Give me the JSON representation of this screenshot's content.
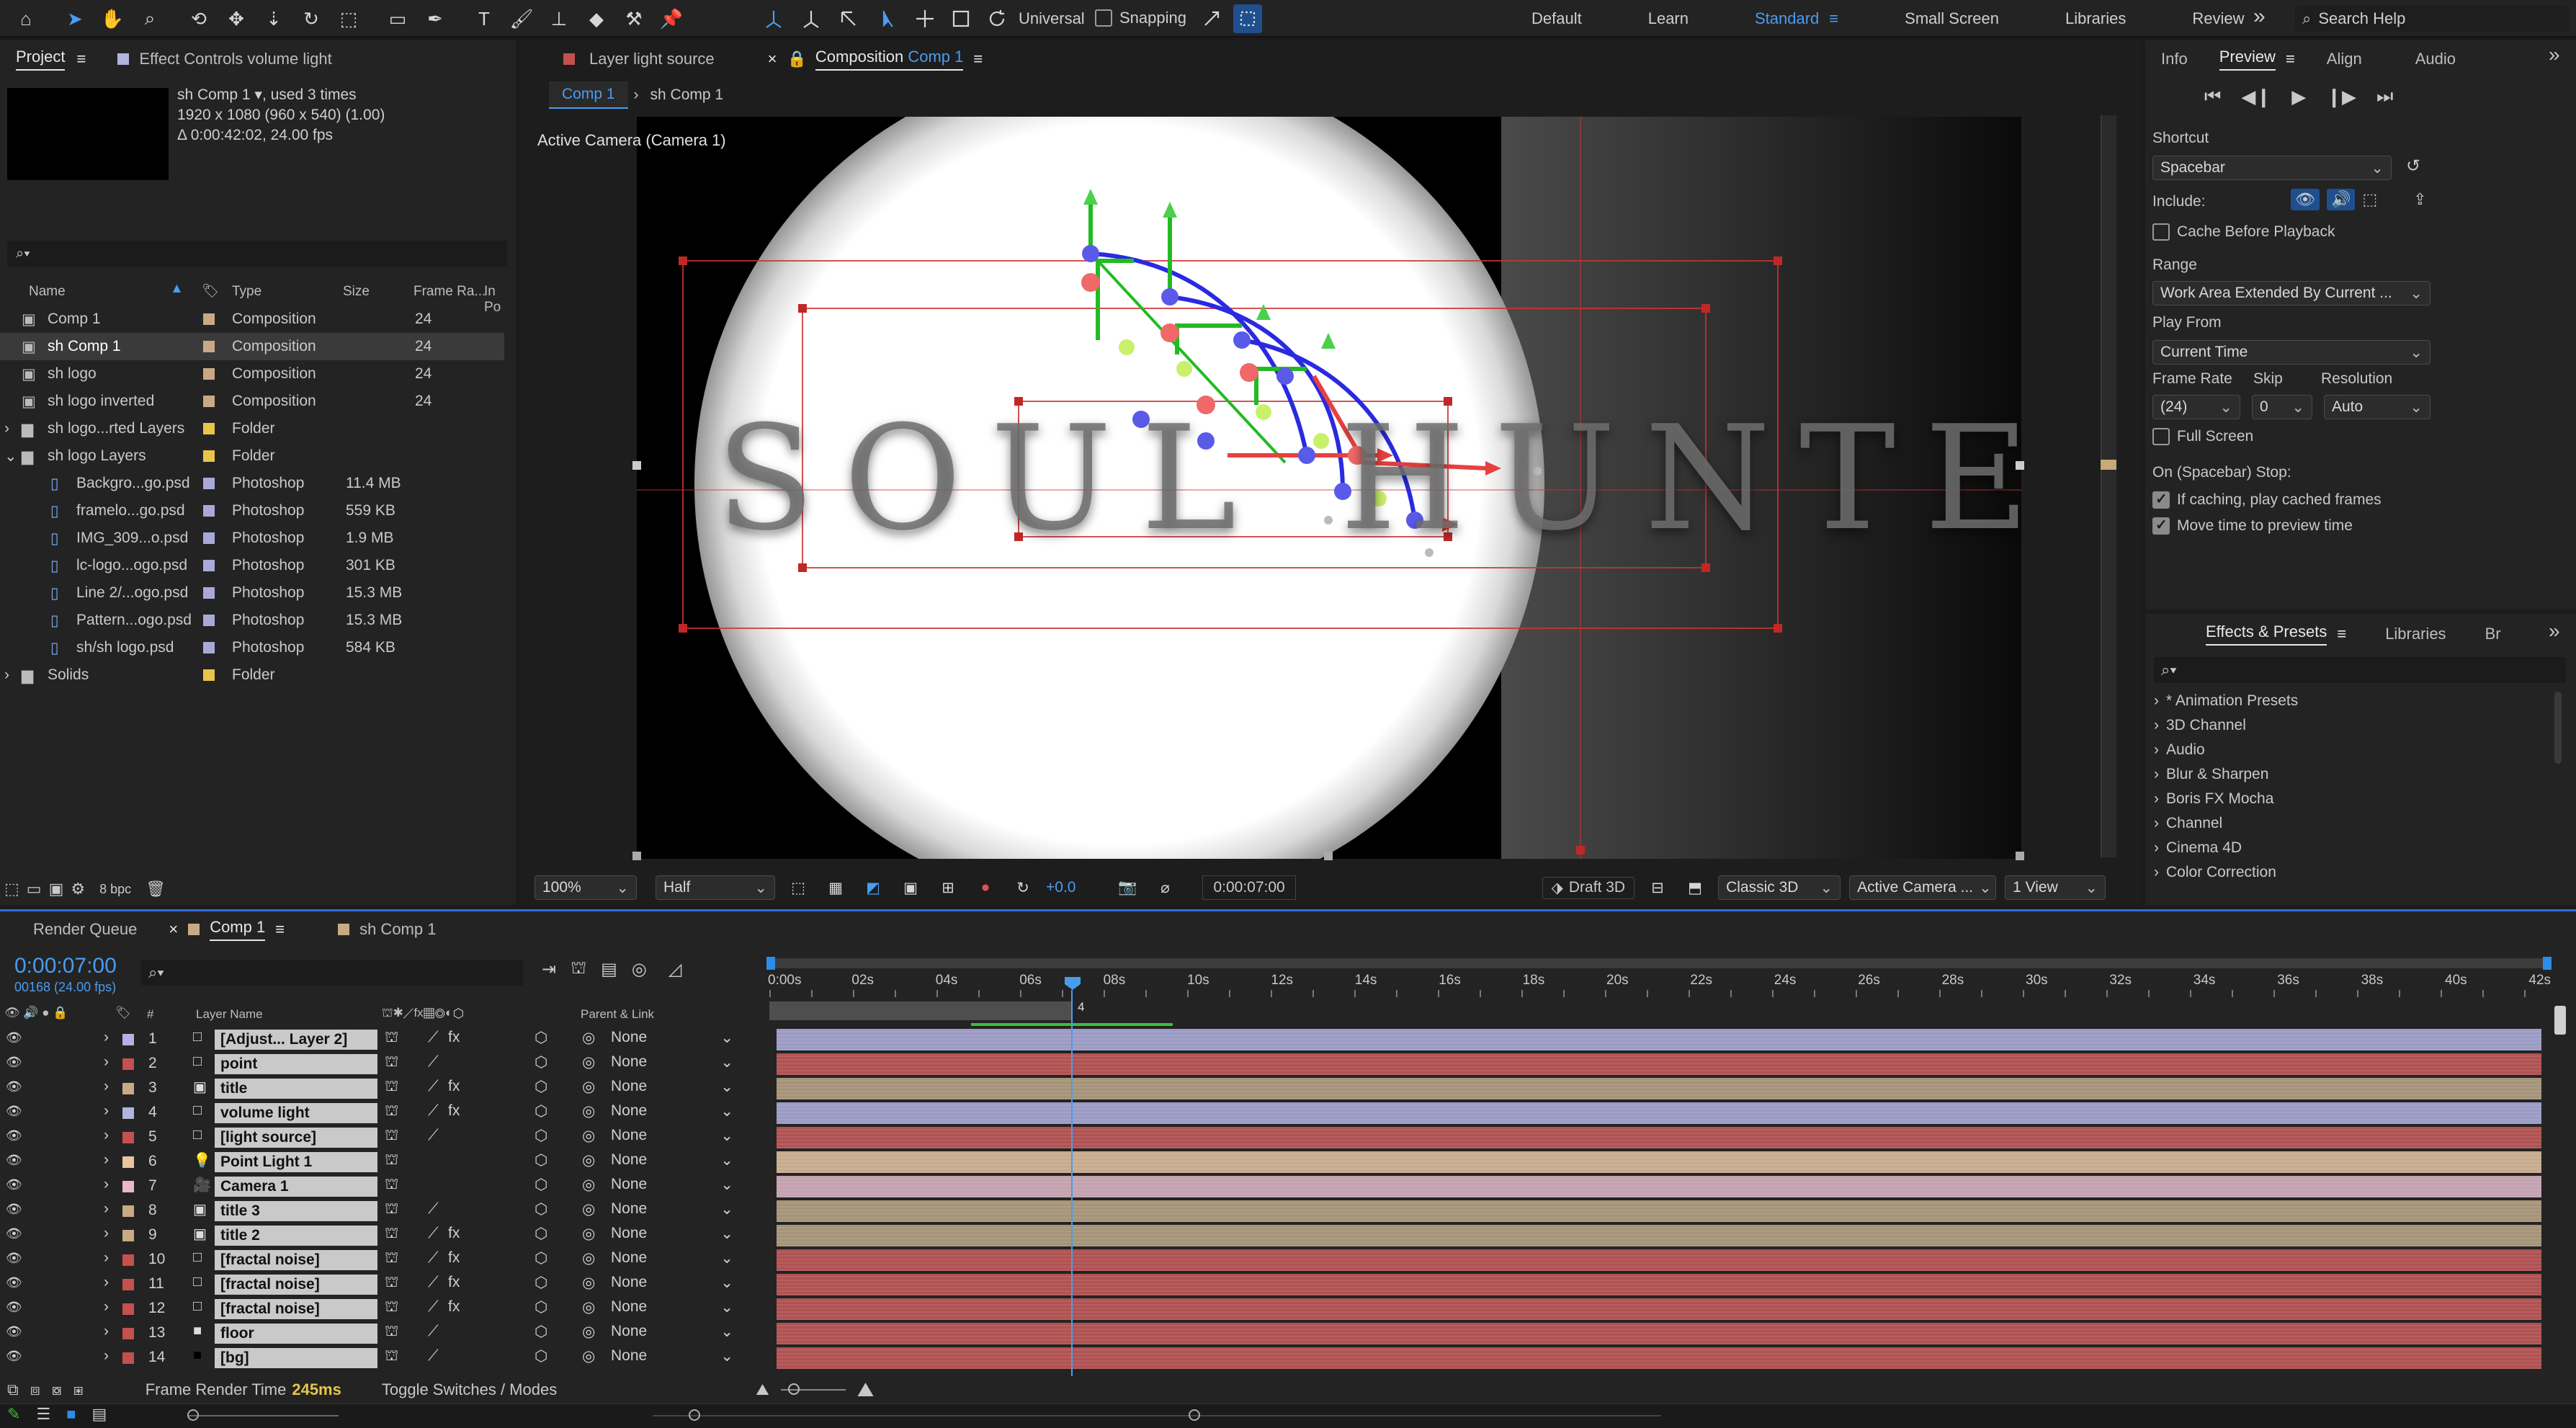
{
  "toolbar": {
    "tools": [
      "home-icon",
      "selection-tool-icon",
      "hand-tool-icon",
      "zoom-tool-icon",
      "orbit-camera-icon",
      "pan-camera-icon",
      "dolly-camera-icon",
      "rotation-tool-icon",
      "pan-behind-icon",
      "rectangle-tool-icon",
      "pen-tool-icon",
      "type-tool-icon",
      "brush-tool-icon",
      "clone-stamp-icon",
      "eraser-icon",
      "roto-brush-icon",
      "puppet-pin-icon"
    ],
    "axis_mode": "Universal",
    "snapping_label": "Snapping",
    "workspaces": [
      "Default",
      "Learn",
      "Standard",
      "Small Screen",
      "Libraries",
      "Review"
    ],
    "active_workspace": "Standard",
    "search_placeholder": "Search Help"
  },
  "project_panel": {
    "tab_project": "Project",
    "tab_effect_controls": "Effect Controls volume light",
    "comp_name": "sh Comp 1",
    "comp_usage": ", used 3 times",
    "comp_size": "1920 x 1080  (960 x 540) (1.00)",
    "comp_duration": "Δ 0:00:42:02, 24.00 fps",
    "columns": [
      "Name",
      "Type",
      "Size",
      "Frame Ra...",
      "In Po"
    ],
    "items": [
      {
        "name": "Comp 1",
        "type": "Composition",
        "size": "",
        "fps": "24",
        "kind": "comp",
        "color": "#c9a985",
        "indent": 0,
        "selected": false
      },
      {
        "name": "sh Comp 1",
        "type": "Composition",
        "size": "",
        "fps": "24",
        "kind": "comp",
        "color": "#c9a985",
        "indent": 0,
        "selected": true
      },
      {
        "name": "sh logo",
        "type": "Composition",
        "size": "",
        "fps": "24",
        "kind": "comp",
        "color": "#c9a985",
        "indent": 0,
        "selected": false
      },
      {
        "name": "sh logo inverted",
        "type": "Composition",
        "size": "",
        "fps": "24",
        "kind": "comp",
        "color": "#c9a985",
        "indent": 0,
        "selected": false
      },
      {
        "name": "sh logo...rted Layers",
        "type": "Folder",
        "size": "",
        "fps": "",
        "kind": "folder",
        "color": "#e8c54a",
        "indent": 0,
        "selected": false
      },
      {
        "name": "sh logo Layers",
        "type": "Folder",
        "size": "",
        "fps": "",
        "kind": "folder",
        "color": "#e8c54a",
        "indent": 0,
        "selected": false
      },
      {
        "name": "Backgro...go.psd",
        "type": "Photoshop",
        "size": "11.4 MB",
        "fps": "",
        "kind": "psd",
        "color": "#a9a9d9",
        "indent": 1,
        "selected": false
      },
      {
        "name": "framelo...go.psd",
        "type": "Photoshop",
        "size": "559 KB",
        "fps": "",
        "kind": "psd",
        "color": "#a9a9d9",
        "indent": 1,
        "selected": false
      },
      {
        "name": "IMG_309...o.psd",
        "type": "Photoshop",
        "size": "1.9 MB",
        "fps": "",
        "kind": "psd",
        "color": "#a9a9d9",
        "indent": 1,
        "selected": false
      },
      {
        "name": "lc-logo...ogo.psd",
        "type": "Photoshop",
        "size": "301 KB",
        "fps": "",
        "kind": "psd",
        "color": "#a9a9d9",
        "indent": 1,
        "selected": false
      },
      {
        "name": "Line 2/...ogo.psd",
        "type": "Photoshop",
        "size": "15.3 MB",
        "fps": "",
        "kind": "psd",
        "color": "#a9a9d9",
        "indent": 1,
        "selected": false
      },
      {
        "name": "Pattern...ogo.psd",
        "type": "Photoshop",
        "size": "15.3 MB",
        "fps": "",
        "kind": "psd",
        "color": "#a9a9d9",
        "indent": 1,
        "selected": false
      },
      {
        "name": "sh/sh logo.psd",
        "type": "Photoshop",
        "size": "584 KB",
        "fps": "",
        "kind": "psd",
        "color": "#a9a9d9",
        "indent": 1,
        "selected": false
      },
      {
        "name": "Solids",
        "type": "Folder",
        "size": "",
        "fps": "",
        "kind": "folder",
        "color": "#e8c54a",
        "indent": 0,
        "selected": false
      }
    ],
    "bpc": "8 bpc"
  },
  "viewer": {
    "tab_layer": "Layer light source",
    "tab_comp_prefix": "Composition",
    "tab_comp_name": "Comp 1",
    "breadcrumbs": [
      "Comp 1",
      "sh Comp 1"
    ],
    "camera_label": "Active Camera (Camera 1)",
    "title_text": "SOUL HUNTER",
    "zoom": "100%",
    "resolution": "Half",
    "exposure": "+0.0",
    "timecode": "0:00:07:00",
    "draft3d": "Draft 3D",
    "renderer": "Classic 3D",
    "camera": "Active Camera ...",
    "views": "1 View"
  },
  "preview_panel": {
    "tabs": [
      "Info",
      "Preview",
      "Align",
      "Audio"
    ],
    "active_tab": "Preview",
    "shortcut_label": "Shortcut",
    "shortcut_value": "Spacebar",
    "include_label": "Include:",
    "cache_before": "Cache Before Playback",
    "range_label": "Range",
    "range_value": "Work Area Extended By Current ...",
    "play_from_label": "Play From",
    "play_from_value": "Current Time",
    "frame_rate_label": "Frame Rate",
    "skip_label": "Skip",
    "resolution_label": "Resolution",
    "frame_rate_value": "(24)",
    "skip_value": "0",
    "resolution_value": "Auto",
    "full_screen": "Full Screen",
    "on_stop_label": "On (Spacebar) Stop:",
    "if_caching": "If caching, play cached frames",
    "move_time": "Move time to preview time"
  },
  "effects_panel": {
    "tabs": [
      "Effects & Presets",
      "Libraries",
      "Br"
    ],
    "items": [
      "* Animation Presets",
      "3D Channel",
      "Audio",
      "Blur & Sharpen",
      "Boris FX Mocha",
      "Channel",
      "Cinema 4D",
      "Color Correction"
    ]
  },
  "timeline": {
    "tabs": [
      "Render Queue",
      "Comp 1",
      "sh Comp 1"
    ],
    "timecode": "0:00:07:00",
    "frame_info": "00168 (24.00 fps)",
    "col_num": "#",
    "col_layer": "Layer Name",
    "col_parent": "Parent & Link",
    "ruler": [
      "0:00s",
      "02s",
      "04s",
      "06s",
      "08s",
      "10s",
      "12s",
      "14s",
      "16s",
      "18s",
      "20s",
      "22s",
      "24s",
      "26s",
      "28s",
      "30s",
      "32s",
      "34s",
      "36s",
      "38s",
      "40s",
      "42s"
    ],
    "cti_label": "4",
    "layers": [
      {
        "num": "1",
        "name": "[Adjust... Layer 2]",
        "label": "#b3b3e0",
        "icon": "solid",
        "fx": true,
        "parent": "None",
        "bar": "#9b9bc4"
      },
      {
        "num": "2",
        "name": "point",
        "label": "#c45050",
        "icon": "solid",
        "fx": false,
        "parent": "None",
        "bar": "#b05252"
      },
      {
        "num": "3",
        "name": "title",
        "label": "#c8aa84",
        "icon": "comp",
        "fx": true,
        "parent": "None",
        "bar": "#a69479"
      },
      {
        "num": "4",
        "name": "volume light",
        "label": "#b3b3e0",
        "icon": "solid",
        "fx": true,
        "parent": "None",
        "bar": "#9b9bc4"
      },
      {
        "num": "5",
        "name": "[light source]",
        "label": "#c45050",
        "icon": "solid",
        "fx": false,
        "parent": "None",
        "bar": "#b05252"
      },
      {
        "num": "6",
        "name": "Point Light 1",
        "label": "#e8c59e",
        "icon": "light",
        "fx": false,
        "parent": "None",
        "bar": "#c7ab8f"
      },
      {
        "num": "7",
        "name": "Camera 1",
        "label": "#e8b7c9",
        "icon": "camera",
        "fx": false,
        "parent": "None",
        "bar": "#c4a2b0"
      },
      {
        "num": "8",
        "name": "title 3",
        "label": "#c8aa84",
        "icon": "comp",
        "fx": false,
        "parent": "None",
        "bar": "#a69479"
      },
      {
        "num": "9",
        "name": "title 2",
        "label": "#c8aa84",
        "icon": "comp",
        "fx": true,
        "parent": "None",
        "bar": "#a69479"
      },
      {
        "num": "10",
        "name": "[fractal noise]",
        "label": "#c45050",
        "icon": "solid",
        "fx": true,
        "parent": "None",
        "bar": "#b05252"
      },
      {
        "num": "11",
        "name": "[fractal noise]",
        "label": "#c45050",
        "icon": "solid",
        "fx": true,
        "parent": "None",
        "bar": "#b05252"
      },
      {
        "num": "12",
        "name": "[fractal noise]",
        "label": "#c45050",
        "icon": "solid",
        "fx": true,
        "parent": "None",
        "bar": "#b05252"
      },
      {
        "num": "13",
        "name": "floor",
        "label": "#c45050",
        "icon": "dark",
        "fx": false,
        "parent": "None",
        "bar": "#b05252"
      },
      {
        "num": "14",
        "name": "[bg]",
        "label": "#c45050",
        "icon": "black",
        "fx": false,
        "parent": "None",
        "bar": "#b05252"
      }
    ],
    "frame_render_label": "Frame Render Time",
    "frame_render_value": "245ms",
    "toggle_label": "Toggle Switches / Modes"
  },
  "colors": {
    "accent": "#2d8ceb",
    "selection": "#4b7fd6",
    "panel": "#232323"
  }
}
